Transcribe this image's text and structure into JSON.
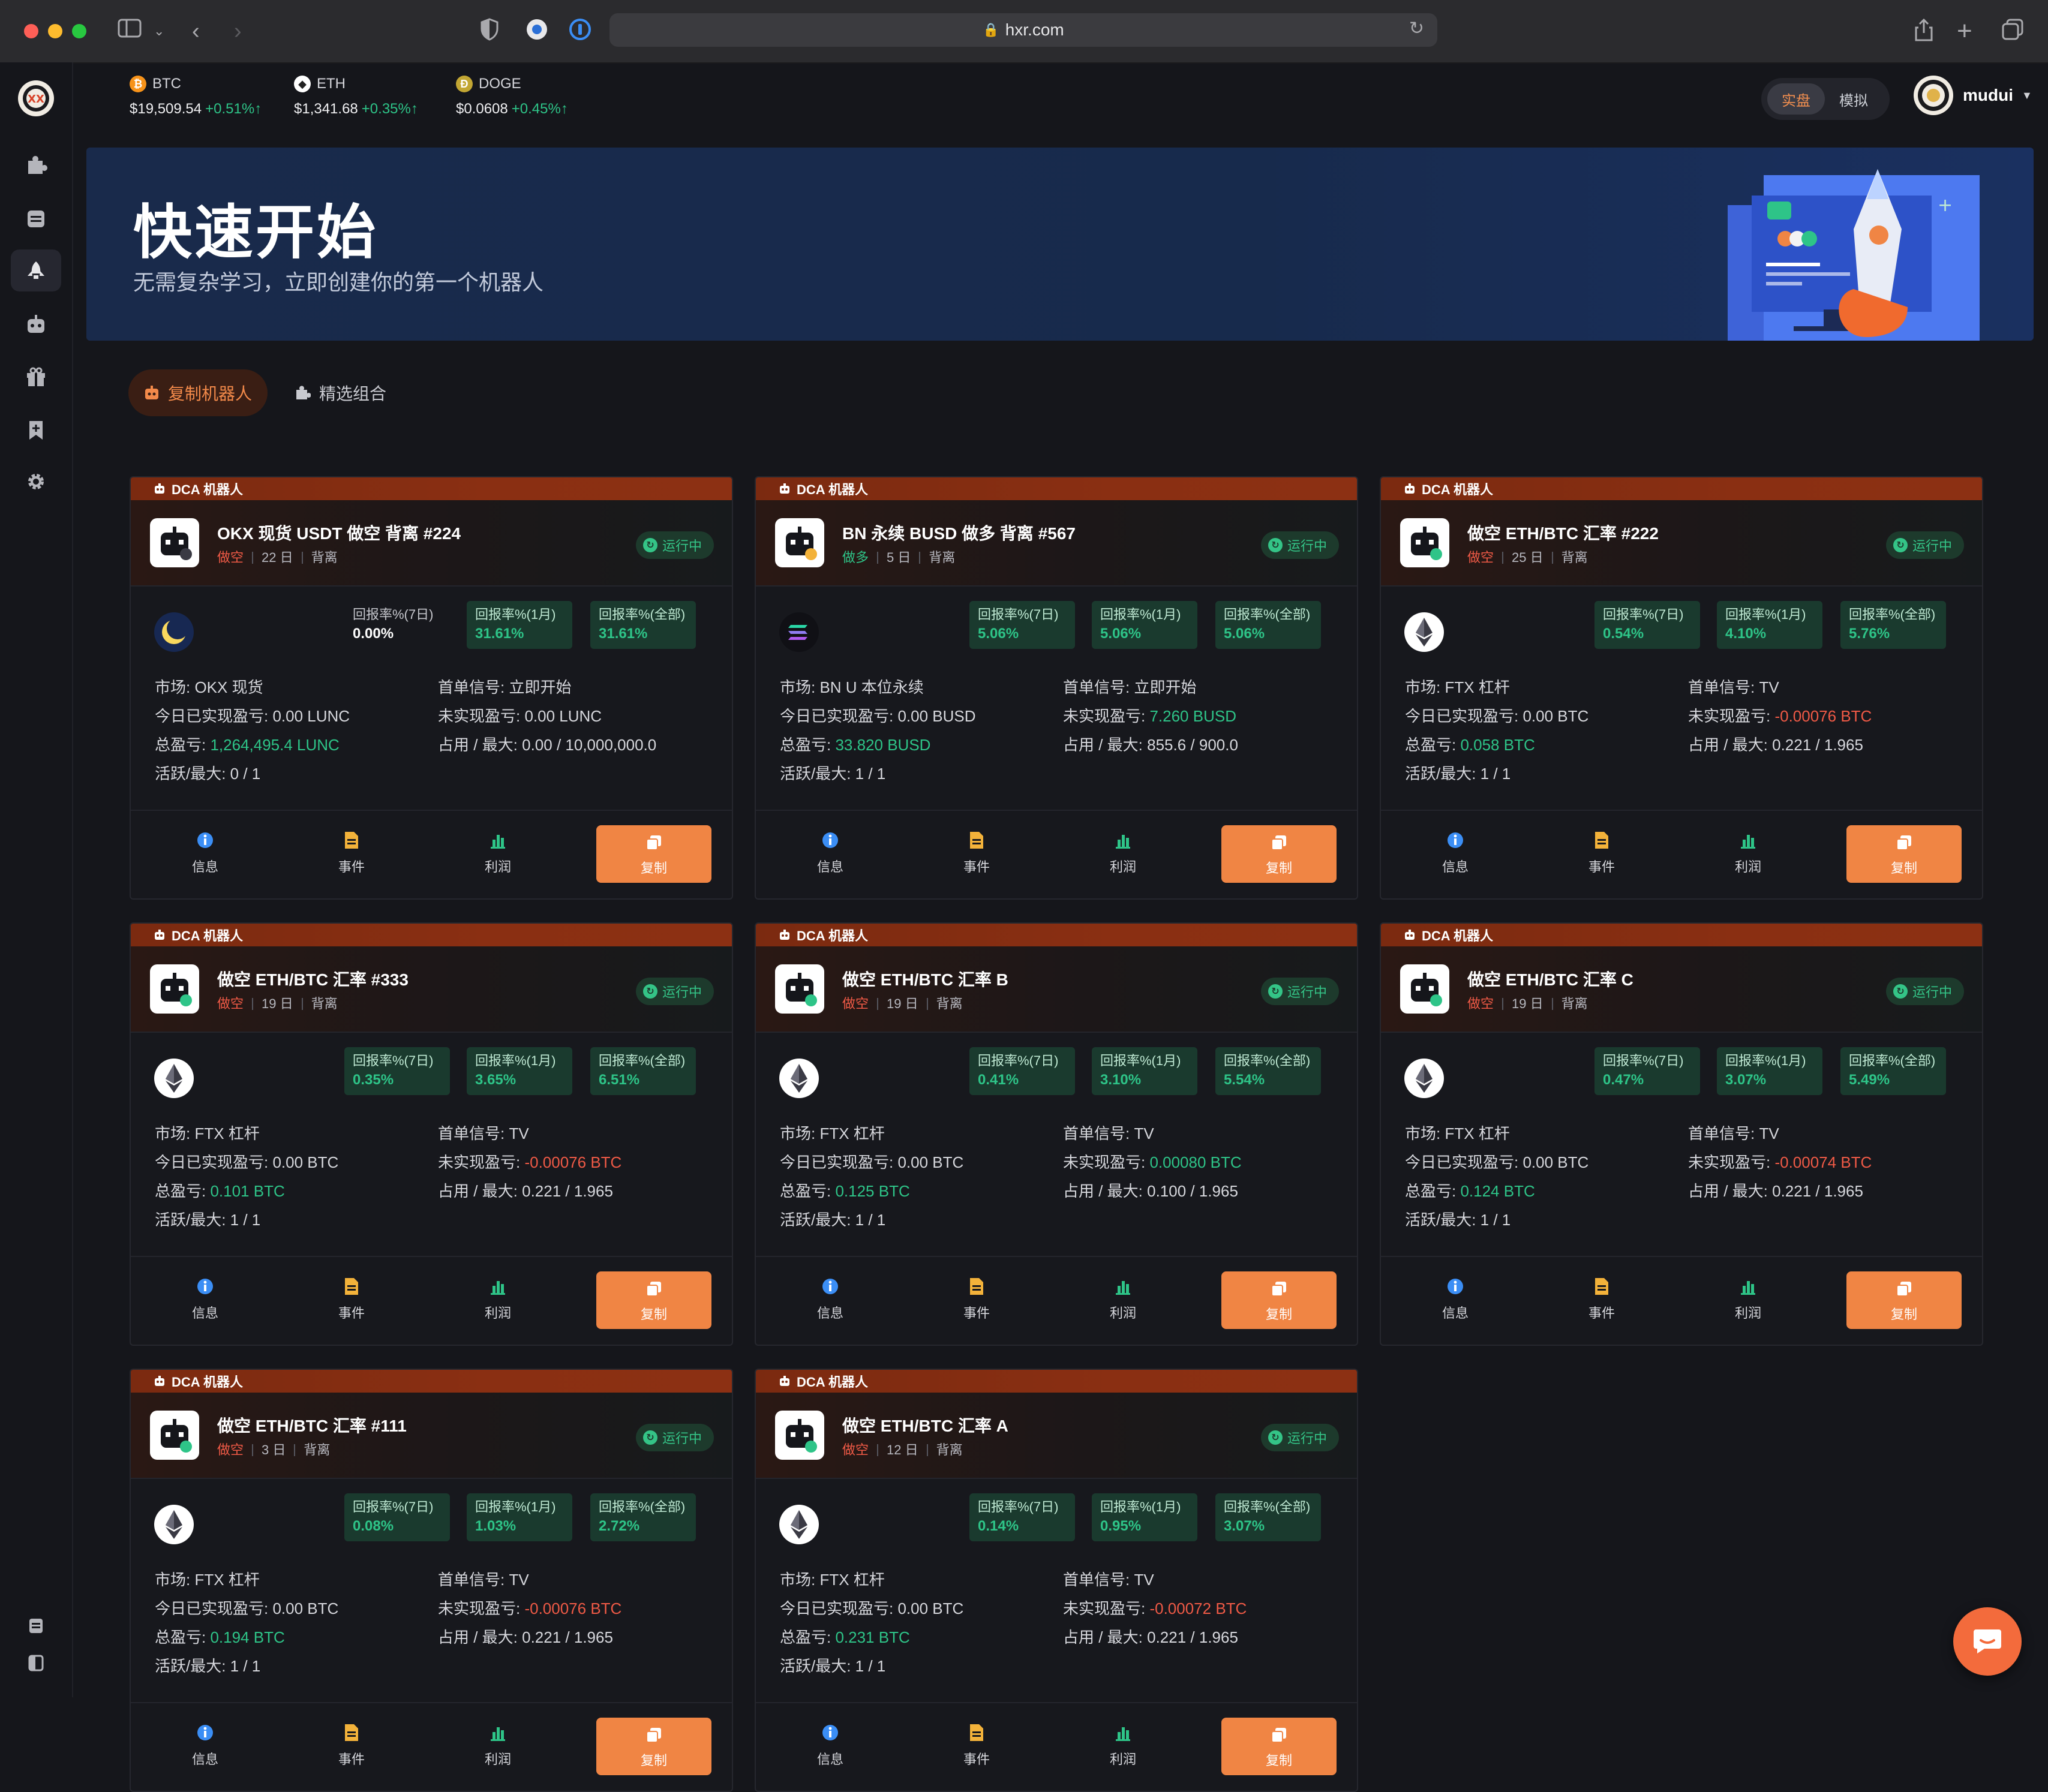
{
  "browser": {
    "url": "hxr.com"
  },
  "topbar": {
    "tickers": [
      {
        "symbol": "BTC",
        "price": "$19,509.54",
        "change": "+0.51%↑",
        "icon": "bitcoin-coin-icon",
        "color": "#f7931a",
        "glyph": "₿"
      },
      {
        "symbol": "ETH",
        "price": "$1,341.68",
        "change": "+0.35%↑",
        "icon": "ethereum-coin-icon",
        "color": "#ffffff",
        "glyph": "◆"
      },
      {
        "symbol": "DOGE",
        "price": "$0.0608",
        "change": "+0.45%↑",
        "icon": "dogecoin-coin-icon",
        "color": "#c2a633",
        "glyph": "Ð"
      }
    ],
    "mode_live": "实盘",
    "mode_sim": "模拟",
    "username": "mudui"
  },
  "hero": {
    "title": "快速开始",
    "subtitle": "无需复杂学习，立即创建你的第一个机器人"
  },
  "tabs": {
    "copy_bots": "复制机器人",
    "curated": "精选组合"
  },
  "labels": {
    "bot_type": "DCA 机器人",
    "status": "运行中",
    "roi7": "回报率%(7日)",
    "roi1m": "回报率%(1月)",
    "roiall": "回报率%(全部)",
    "market": "市场: ",
    "first_signal": "首单信号: ",
    "today_pnl": "今日已实现盈亏: ",
    "unrealized": "未实现盈亏: ",
    "total_pnl": "总盈亏: ",
    "used_max": "占用 / 最大: ",
    "active_max": "活跃/最大: ",
    "info": "信息",
    "events": "事件",
    "profit": "利润",
    "copy": "复制"
  },
  "cards": [
    {
      "name": "OKX 现货 USDT 做空 背离 #224",
      "direction": "做空",
      "days": "22 日",
      "tag": "背离",
      "coin": "luna",
      "roi7": "0.00%",
      "roi1m": "31.61%",
      "roiall": "31.61%",
      "roi7_positive": false,
      "market": "OKX 现货",
      "first_signal": "立即开始",
      "today_pnl": "0.00 LUNC",
      "unrealized": "0.00 LUNC",
      "unrealized_tone": "n",
      "total_pnl": "1,264,495.4 LUNC",
      "used_max": "0.00 / 10,000,000.0",
      "active_max": "0 / 1"
    },
    {
      "name": "BN 永续 BUSD 做多 背离 #567",
      "direction": "做多",
      "days": "5 日",
      "tag": "背离",
      "coin": "sol",
      "roi7": "5.06%",
      "roi1m": "5.06%",
      "roiall": "5.06%",
      "roi7_positive": true,
      "market": "BN U 本位永续",
      "first_signal": "立即开始",
      "today_pnl": "0.00 BUSD",
      "unrealized": "7.260 BUSD",
      "unrealized_tone": "g",
      "total_pnl": "33.820 BUSD",
      "used_max": "855.6 / 900.0",
      "active_max": "1 / 1"
    },
    {
      "name": "做空 ETH/BTC 汇率 #222",
      "direction": "做空",
      "days": "25 日",
      "tag": "背离",
      "coin": "eth",
      "roi7": "0.54%",
      "roi1m": "4.10%",
      "roiall": "5.76%",
      "roi7_positive": true,
      "market": "FTX 杠杆",
      "first_signal": "TV",
      "today_pnl": "0.00 BTC",
      "unrealized": "-0.00076 BTC",
      "unrealized_tone": "r",
      "total_pnl": "0.058 BTC",
      "used_max": "0.221 / 1.965",
      "active_max": "1 / 1"
    },
    {
      "name": "做空 ETH/BTC 汇率 #333",
      "direction": "做空",
      "days": "19 日",
      "tag": "背离",
      "coin": "eth",
      "roi7": "0.35%",
      "roi1m": "3.65%",
      "roiall": "6.51%",
      "roi7_positive": true,
      "market": "FTX 杠杆",
      "first_signal": "TV",
      "today_pnl": "0.00 BTC",
      "unrealized": "-0.00076 BTC",
      "unrealized_tone": "r",
      "total_pnl": "0.101 BTC",
      "used_max": "0.221 / 1.965",
      "active_max": "1 / 1"
    },
    {
      "name": "做空 ETH/BTC 汇率 B",
      "direction": "做空",
      "days": "19 日",
      "tag": "背离",
      "coin": "eth",
      "roi7": "0.41%",
      "roi1m": "3.10%",
      "roiall": "5.54%",
      "roi7_positive": true,
      "market": "FTX 杠杆",
      "first_signal": "TV",
      "today_pnl": "0.00 BTC",
      "unrealized": "0.00080 BTC",
      "unrealized_tone": "g",
      "total_pnl": "0.125 BTC",
      "used_max": "0.100 / 1.965",
      "active_max": "1 / 1"
    },
    {
      "name": "做空 ETH/BTC 汇率 C",
      "direction": "做空",
      "days": "19 日",
      "tag": "背离",
      "coin": "eth",
      "roi7": "0.47%",
      "roi1m": "3.07%",
      "roiall": "5.49%",
      "roi7_positive": true,
      "market": "FTX 杠杆",
      "first_signal": "TV",
      "today_pnl": "0.00 BTC",
      "unrealized": "-0.00074 BTC",
      "unrealized_tone": "r",
      "total_pnl": "0.124 BTC",
      "used_max": "0.221 / 1.965",
      "active_max": "1 / 1"
    },
    {
      "name": "做空 ETH/BTC 汇率 #111",
      "direction": "做空",
      "days": "3 日",
      "tag": "背离",
      "coin": "eth",
      "roi7": "0.08%",
      "roi1m": "1.03%",
      "roiall": "2.72%",
      "roi7_positive": true,
      "market": "FTX 杠杆",
      "first_signal": "TV",
      "today_pnl": "0.00 BTC",
      "unrealized": "-0.00076 BTC",
      "unrealized_tone": "r",
      "total_pnl": "0.194 BTC",
      "used_max": "0.221 / 1.965",
      "active_max": "1 / 1"
    },
    {
      "name": "做空 ETH/BTC 汇率 A",
      "direction": "做空",
      "days": "12 日",
      "tag": "背离",
      "coin": "eth",
      "roi7": "0.14%",
      "roi1m": "0.95%",
      "roiall": "3.07%",
      "roi7_positive": true,
      "market": "FTX 杠杆",
      "first_signal": "TV",
      "today_pnl": "0.00 BTC",
      "unrealized": "-0.00072 BTC",
      "unrealized_tone": "r",
      "total_pnl": "0.231 BTC",
      "used_max": "0.221 / 1.965",
      "active_max": "1 / 1"
    }
  ]
}
